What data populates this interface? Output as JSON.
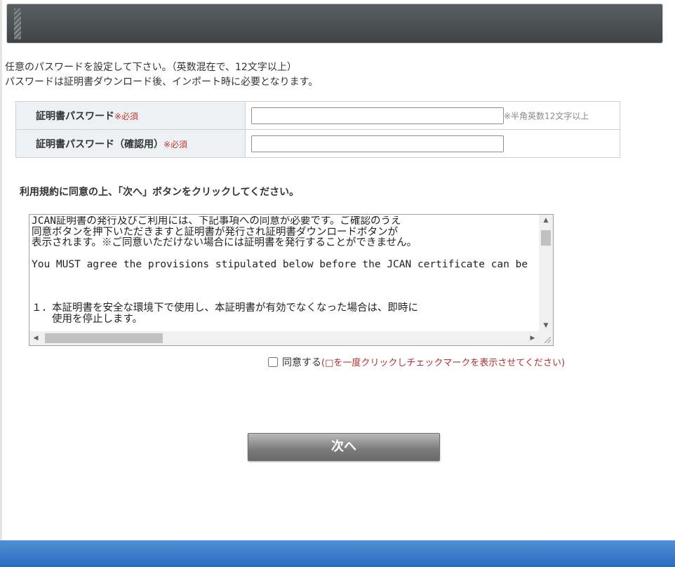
{
  "intro": {
    "line1": "任意のパスワードを設定して下さい。（英数混在で、12文字以上）",
    "line2": "パスワードは証明書ダウンロード後、インポート時に必要となります。"
  },
  "form": {
    "password_label": "証明書パスワード",
    "password_required": "※必須",
    "password_value": "",
    "password_hint": "※半角英数12文字以上",
    "confirm_label": "証明書パスワード（確認用）",
    "confirm_required": "※必須",
    "confirm_value": ""
  },
  "instruction": "利用規約に同意の上、「次へ」ボタンをクリックしてください。",
  "terms": {
    "text": "JCAN証明書の発行及びご利用には、下記事項への同意が必要です。ご確認のうえ\n同意ボタンを押下いただきますと証明書が発行され証明書ダウンロードボタンが\n表示されます。※ご同意いただけない場合には証明書を発行することができません。\n\nYou MUST agree the provisions stipulated below before the JCAN certificate can be\n\n\n\n１．本証明書を安全な環境下で使用し、本証明書が有効でなくなった場合は、即時に\n　　使用を停止します。",
    "checked": false
  },
  "agree": {
    "label": "同意する",
    "note": "(□を一度クリックしチェックマークを表示させてください)"
  },
  "next_button": "次へ",
  "colors": {
    "header": "#45494c",
    "footer": "#2f72c4",
    "required": "#c0392b"
  }
}
